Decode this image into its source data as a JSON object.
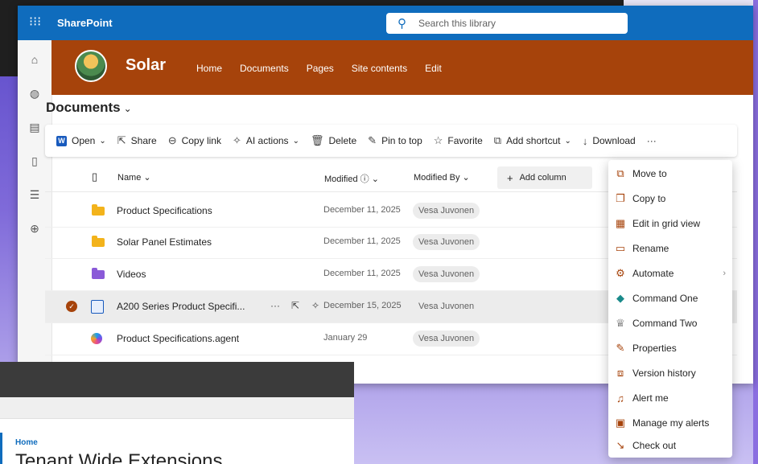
{
  "topbar": {
    "brand": "SharePoint",
    "search_placeholder": "Search this library"
  },
  "site": {
    "title": "Solar",
    "nav": [
      "Home",
      "Documents",
      "Pages",
      "Site contents",
      "Edit"
    ]
  },
  "library": {
    "title": "Documents"
  },
  "commands": {
    "open": "Open",
    "share": "Share",
    "copy_link": "Copy link",
    "ai_actions": "AI actions",
    "delete": "Delete",
    "pin_to_top": "Pin to top",
    "favorite": "Favorite",
    "add_shortcut": "Add shortcut",
    "download": "Download",
    "more": "···"
  },
  "columns": {
    "name": "Name",
    "modified": "Modified",
    "modified_by": "Modified By",
    "add_column": "Add column"
  },
  "rows": [
    {
      "name": "Product Specifications",
      "modified": "December 11, 2025",
      "by": "Vesa Juvonen",
      "kind": "folder"
    },
    {
      "name": "Solar Panel Estimates",
      "modified": "December 11, 2025",
      "by": "Vesa Juvonen",
      "kind": "folder"
    },
    {
      "name": "Videos",
      "modified": "December 11, 2025",
      "by": "Vesa Juvonen",
      "kind": "folder-purple"
    },
    {
      "name": "A200 Series Product Specifi...",
      "modified": "December 15, 2025",
      "by": "Vesa Juvonen",
      "kind": "file-selected"
    },
    {
      "name": "Product Specifications.agent",
      "modified": "January 29",
      "by": "Vesa Juvonen",
      "kind": "agent"
    }
  ],
  "context_menu": [
    {
      "label": "Move to",
      "icon": "move-icon"
    },
    {
      "label": "Copy to",
      "icon": "copy-icon"
    },
    {
      "label": "Edit in grid view",
      "icon": "grid-icon"
    },
    {
      "label": "Rename",
      "icon": "rename-icon"
    },
    {
      "label": "Automate",
      "icon": "automate-icon"
    },
    {
      "label": "Command One",
      "icon": "command-one-icon"
    },
    {
      "label": "Command Two",
      "icon": "trophy-icon"
    },
    {
      "label": "Properties",
      "icon": "pencil-icon"
    },
    {
      "label": "Version history",
      "icon": "history-icon"
    },
    {
      "label": "Alert me",
      "icon": "bell-icon"
    },
    {
      "label": "Manage my alerts",
      "icon": "manage-alerts-icon"
    },
    {
      "label": "Check out",
      "icon": "check-out-icon"
    }
  ],
  "second_window": {
    "breadcrumb": "Home",
    "title": "Tenant Wide Extensions"
  },
  "colors": {
    "suite_blue": "#0f6cbd",
    "site_brown": "#a6430b",
    "folder_yellow": "#f3b31b",
    "folder_purple": "#8a5ad8"
  }
}
